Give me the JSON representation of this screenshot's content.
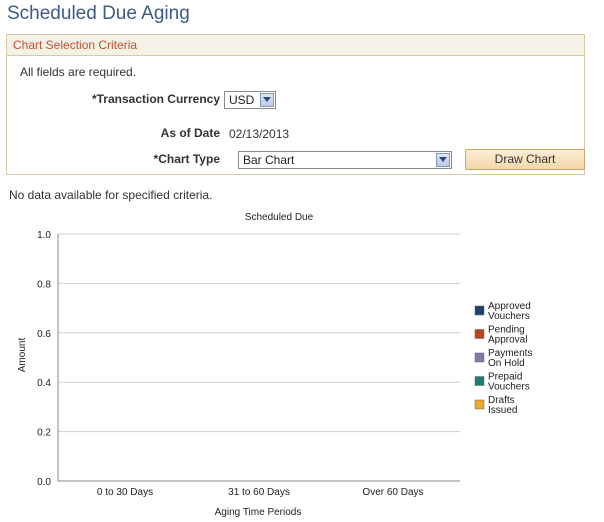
{
  "page": {
    "title": "Scheduled Due Aging"
  },
  "criteria": {
    "header": "Chart Selection Criteria",
    "required_note": "All fields are required.",
    "currency_label": "*Transaction Currency",
    "currency_value": "USD",
    "asof_label": "As of Date",
    "asof_value": "02/13/2013",
    "chart_type_label": "*Chart Type",
    "chart_type_value": "Bar Chart",
    "draw_button": "Draw Chart"
  },
  "message": "No data available for specified criteria.",
  "chart_data": {
    "type": "bar",
    "title": "Scheduled Due",
    "xlabel": "Aging Time Periods",
    "ylabel": "Amount",
    "categories": [
      "0 to 30 Days",
      "31 to 60 Days",
      "Over 60 Days"
    ],
    "yticks": [
      "0.0",
      "0.2",
      "0.4",
      "0.6",
      "0.8",
      "1.0"
    ],
    "ylim": [
      0,
      1
    ],
    "grid": true,
    "legend_position": "right",
    "series": [
      {
        "name": "Approved Vouchers",
        "name_lines": [
          "Approved",
          "Vouchers"
        ],
        "color": "#1f3f6e",
        "values": []
      },
      {
        "name": "Pending Approval",
        "name_lines": [
          "Pending",
          "Approval"
        ],
        "color": "#c0431f",
        "values": []
      },
      {
        "name": "Payments On Hold",
        "name_lines": [
          "Payments",
          "On Hold"
        ],
        "color": "#7d7aa6",
        "values": []
      },
      {
        "name": "Prepaid Vouchers",
        "name_lines": [
          "Prepaid",
          "Vouchers"
        ],
        "color": "#1f7a78",
        "values": []
      },
      {
        "name": "Drafts Issued",
        "name_lines": [
          "Drafts",
          "Issued"
        ],
        "color": "#f2a72a",
        "values": []
      }
    ]
  }
}
